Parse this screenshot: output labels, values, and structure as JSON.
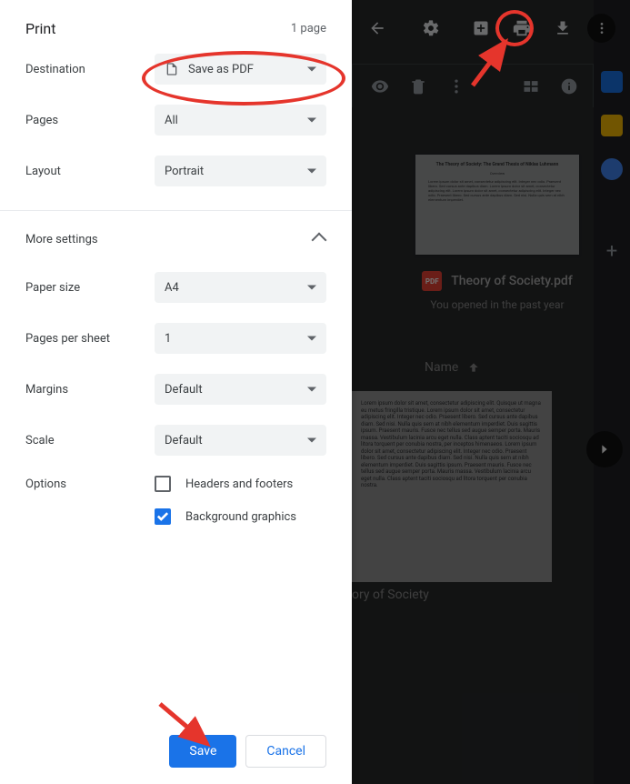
{
  "header": {
    "title": "Print",
    "page_count": "1 page"
  },
  "fields": {
    "destination": {
      "label": "Destination",
      "value": "Save as PDF"
    },
    "pages": {
      "label": "Pages",
      "value": "All"
    },
    "layout": {
      "label": "Layout",
      "value": "Portrait"
    },
    "more_settings": "More settings",
    "paper_size": {
      "label": "Paper size",
      "value": "A4"
    },
    "pages_per_sheet": {
      "label": "Pages per sheet",
      "value": "1"
    },
    "margins": {
      "label": "Margins",
      "value": "Default"
    },
    "scale": {
      "label": "Scale",
      "value": "Default"
    },
    "options_label": "Options",
    "headers_footers": "Headers and footers",
    "background_graphics": "Background graphics"
  },
  "buttons": {
    "save": "Save",
    "cancel": "Cancel"
  },
  "preview": {
    "pdf_badge": "PDF",
    "doc_title": "Theory of Society.pdf",
    "open_info": "You opened in the past year",
    "sort_label": "Name",
    "bottom_title": "ory of Society"
  }
}
